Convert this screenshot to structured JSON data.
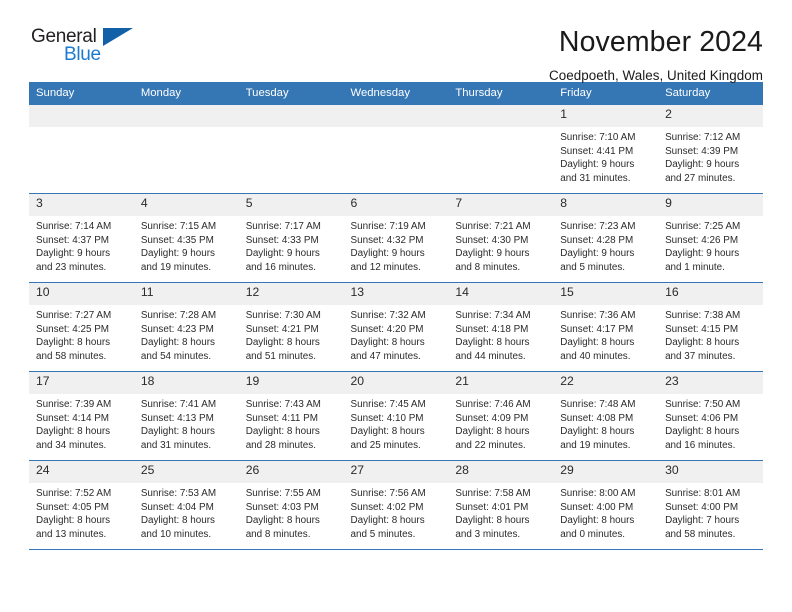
{
  "logo": {
    "word_top": "General",
    "word_bottom": "Blue",
    "triangle_icon": "triangle-icon",
    "brand_color": "#1c7ad1"
  },
  "header": {
    "title": "November 2024",
    "subtitle": "Coedpoeth, Wales, United Kingdom"
  },
  "theme": {
    "header_blue": "#3576b4",
    "daynum_band": "#f0f0f0",
    "text": "#2b2b2b"
  },
  "weekdays": [
    "Sunday",
    "Monday",
    "Tuesday",
    "Wednesday",
    "Thursday",
    "Friday",
    "Saturday"
  ],
  "labels": {
    "sunrise": "Sunrise:",
    "sunset": "Sunset:",
    "daylight": "Daylight:"
  },
  "weeks": [
    [
      {
        "day": "",
        "empty": true
      },
      {
        "day": "",
        "empty": true
      },
      {
        "day": "",
        "empty": true
      },
      {
        "day": "",
        "empty": true
      },
      {
        "day": "",
        "empty": true
      },
      {
        "day": "1",
        "sunrise": "Sunrise: 7:10 AM",
        "sunset": "Sunset: 4:41 PM",
        "daylight": "Daylight: 9 hours and 31 minutes."
      },
      {
        "day": "2",
        "sunrise": "Sunrise: 7:12 AM",
        "sunset": "Sunset: 4:39 PM",
        "daylight": "Daylight: 9 hours and 27 minutes."
      }
    ],
    [
      {
        "day": "3",
        "sunrise": "Sunrise: 7:14 AM",
        "sunset": "Sunset: 4:37 PM",
        "daylight": "Daylight: 9 hours and 23 minutes."
      },
      {
        "day": "4",
        "sunrise": "Sunrise: 7:15 AM",
        "sunset": "Sunset: 4:35 PM",
        "daylight": "Daylight: 9 hours and 19 minutes."
      },
      {
        "day": "5",
        "sunrise": "Sunrise: 7:17 AM",
        "sunset": "Sunset: 4:33 PM",
        "daylight": "Daylight: 9 hours and 16 minutes."
      },
      {
        "day": "6",
        "sunrise": "Sunrise: 7:19 AM",
        "sunset": "Sunset: 4:32 PM",
        "daylight": "Daylight: 9 hours and 12 minutes."
      },
      {
        "day": "7",
        "sunrise": "Sunrise: 7:21 AM",
        "sunset": "Sunset: 4:30 PM",
        "daylight": "Daylight: 9 hours and 8 minutes."
      },
      {
        "day": "8",
        "sunrise": "Sunrise: 7:23 AM",
        "sunset": "Sunset: 4:28 PM",
        "daylight": "Daylight: 9 hours and 5 minutes."
      },
      {
        "day": "9",
        "sunrise": "Sunrise: 7:25 AM",
        "sunset": "Sunset: 4:26 PM",
        "daylight": "Daylight: 9 hours and 1 minute."
      }
    ],
    [
      {
        "day": "10",
        "sunrise": "Sunrise: 7:27 AM",
        "sunset": "Sunset: 4:25 PM",
        "daylight": "Daylight: 8 hours and 58 minutes."
      },
      {
        "day": "11",
        "sunrise": "Sunrise: 7:28 AM",
        "sunset": "Sunset: 4:23 PM",
        "daylight": "Daylight: 8 hours and 54 minutes."
      },
      {
        "day": "12",
        "sunrise": "Sunrise: 7:30 AM",
        "sunset": "Sunset: 4:21 PM",
        "daylight": "Daylight: 8 hours and 51 minutes."
      },
      {
        "day": "13",
        "sunrise": "Sunrise: 7:32 AM",
        "sunset": "Sunset: 4:20 PM",
        "daylight": "Daylight: 8 hours and 47 minutes."
      },
      {
        "day": "14",
        "sunrise": "Sunrise: 7:34 AM",
        "sunset": "Sunset: 4:18 PM",
        "daylight": "Daylight: 8 hours and 44 minutes."
      },
      {
        "day": "15",
        "sunrise": "Sunrise: 7:36 AM",
        "sunset": "Sunset: 4:17 PM",
        "daylight": "Daylight: 8 hours and 40 minutes."
      },
      {
        "day": "16",
        "sunrise": "Sunrise: 7:38 AM",
        "sunset": "Sunset: 4:15 PM",
        "daylight": "Daylight: 8 hours and 37 minutes."
      }
    ],
    [
      {
        "day": "17",
        "sunrise": "Sunrise: 7:39 AM",
        "sunset": "Sunset: 4:14 PM",
        "daylight": "Daylight: 8 hours and 34 minutes."
      },
      {
        "day": "18",
        "sunrise": "Sunrise: 7:41 AM",
        "sunset": "Sunset: 4:13 PM",
        "daylight": "Daylight: 8 hours and 31 minutes."
      },
      {
        "day": "19",
        "sunrise": "Sunrise: 7:43 AM",
        "sunset": "Sunset: 4:11 PM",
        "daylight": "Daylight: 8 hours and 28 minutes."
      },
      {
        "day": "20",
        "sunrise": "Sunrise: 7:45 AM",
        "sunset": "Sunset: 4:10 PM",
        "daylight": "Daylight: 8 hours and 25 minutes."
      },
      {
        "day": "21",
        "sunrise": "Sunrise: 7:46 AM",
        "sunset": "Sunset: 4:09 PM",
        "daylight": "Daylight: 8 hours and 22 minutes."
      },
      {
        "day": "22",
        "sunrise": "Sunrise: 7:48 AM",
        "sunset": "Sunset: 4:08 PM",
        "daylight": "Daylight: 8 hours and 19 minutes."
      },
      {
        "day": "23",
        "sunrise": "Sunrise: 7:50 AM",
        "sunset": "Sunset: 4:06 PM",
        "daylight": "Daylight: 8 hours and 16 minutes."
      }
    ],
    [
      {
        "day": "24",
        "sunrise": "Sunrise: 7:52 AM",
        "sunset": "Sunset: 4:05 PM",
        "daylight": "Daylight: 8 hours and 13 minutes."
      },
      {
        "day": "25",
        "sunrise": "Sunrise: 7:53 AM",
        "sunset": "Sunset: 4:04 PM",
        "daylight": "Daylight: 8 hours and 10 minutes."
      },
      {
        "day": "26",
        "sunrise": "Sunrise: 7:55 AM",
        "sunset": "Sunset: 4:03 PM",
        "daylight": "Daylight: 8 hours and 8 minutes."
      },
      {
        "day": "27",
        "sunrise": "Sunrise: 7:56 AM",
        "sunset": "Sunset: 4:02 PM",
        "daylight": "Daylight: 8 hours and 5 minutes."
      },
      {
        "day": "28",
        "sunrise": "Sunrise: 7:58 AM",
        "sunset": "Sunset: 4:01 PM",
        "daylight": "Daylight: 8 hours and 3 minutes."
      },
      {
        "day": "29",
        "sunrise": "Sunrise: 8:00 AM",
        "sunset": "Sunset: 4:00 PM",
        "daylight": "Daylight: 8 hours and 0 minutes."
      },
      {
        "day": "30",
        "sunrise": "Sunrise: 8:01 AM",
        "sunset": "Sunset: 4:00 PM",
        "daylight": "Daylight: 7 hours and 58 minutes."
      }
    ]
  ]
}
